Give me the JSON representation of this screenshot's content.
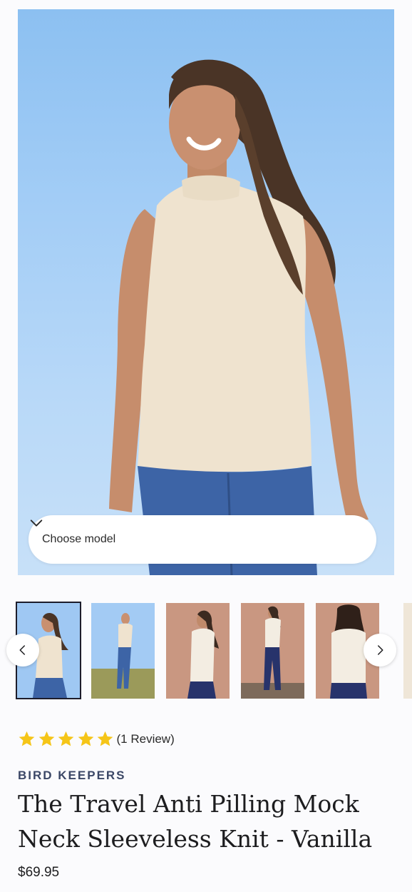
{
  "hero": {
    "image_alt": "Smiling woman wearing a sleeveless cream mock neck knit and blue jeans under a blue sky",
    "choose_model_label": "Choose model"
  },
  "colors": {
    "sky": "#a9d0f7",
    "knit": "#f0e5d2",
    "denim": "#3a5f9e",
    "star": "#f5c518",
    "brand": "#3b4766",
    "thumb_bg_sky": "#9fc8f3",
    "thumb_bg_studio": "#c99781"
  },
  "thumbnails": [
    {
      "name": "front view sky",
      "background": "sky",
      "active": true
    },
    {
      "name": "full length field",
      "background": "sky",
      "active": false
    },
    {
      "name": "studio pose",
      "background": "studio",
      "active": false
    },
    {
      "name": "studio full length",
      "background": "studio",
      "active": false
    },
    {
      "name": "studio back view",
      "background": "studio",
      "active": false
    }
  ],
  "carousel": {
    "prev_icon": "chevron-left-icon",
    "next_icon": "chevron-right-icon"
  },
  "rating": {
    "stars": 5,
    "review_text": "(1 Review)"
  },
  "product": {
    "brand": "BIRD KEEPERS",
    "title": "The Travel Anti Pilling Mock Neck Sleeveless Knit - Vanilla",
    "price": "$69.95"
  }
}
